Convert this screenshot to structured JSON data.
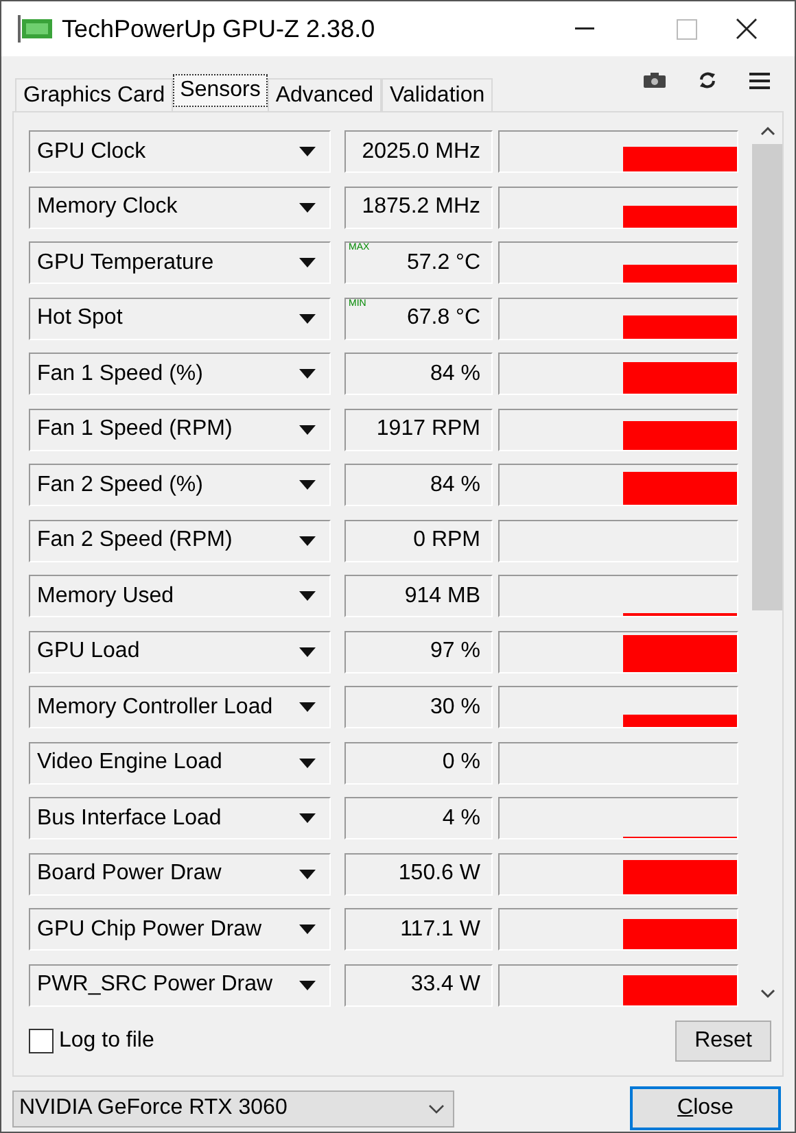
{
  "window": {
    "title": "TechPowerUp GPU-Z 2.38.0"
  },
  "tabs": [
    {
      "label": "Graphics Card",
      "selected": false
    },
    {
      "label": "Sensors",
      "selected": true
    },
    {
      "label": "Advanced",
      "selected": false
    },
    {
      "label": "Validation",
      "selected": false
    }
  ],
  "sensors": [
    {
      "name": "GPU Clock",
      "value": "2025.0 MHz"
    },
    {
      "name": "Memory Clock",
      "value": "1875.2 MHz"
    },
    {
      "name": "GPU Temperature",
      "value": "57.2 °C",
      "badge": "MAX"
    },
    {
      "name": "Hot Spot",
      "value": "67.8 °C",
      "badge": "MIN"
    },
    {
      "name": "Fan 1 Speed (%)",
      "value": "84 %"
    },
    {
      "name": "Fan 1 Speed (RPM)",
      "value": "1917 RPM"
    },
    {
      "name": "Fan 2 Speed (%)",
      "value": "84 %"
    },
    {
      "name": "Fan 2 Speed (RPM)",
      "value": "0 RPM"
    },
    {
      "name": "Memory Used",
      "value": "914 MB"
    },
    {
      "name": "GPU Load",
      "value": "97 %"
    },
    {
      "name": "Memory Controller Load",
      "value": "30 %"
    },
    {
      "name": "Video Engine Load",
      "value": "0 %"
    },
    {
      "name": "Bus Interface Load",
      "value": "4 %"
    },
    {
      "name": "Board Power Draw",
      "value": "150.6 W"
    },
    {
      "name": "GPU Chip Power Draw",
      "value": "117.1 W"
    },
    {
      "name": "PWR_SRC Power Draw",
      "value": "33.4 W"
    }
  ],
  "log_to_file": {
    "label": "Log to file",
    "checked": false
  },
  "reset_button": "Reset",
  "gpu_select": {
    "value": "NVIDIA GeForce RTX 3060"
  },
  "close_button": "Close"
}
